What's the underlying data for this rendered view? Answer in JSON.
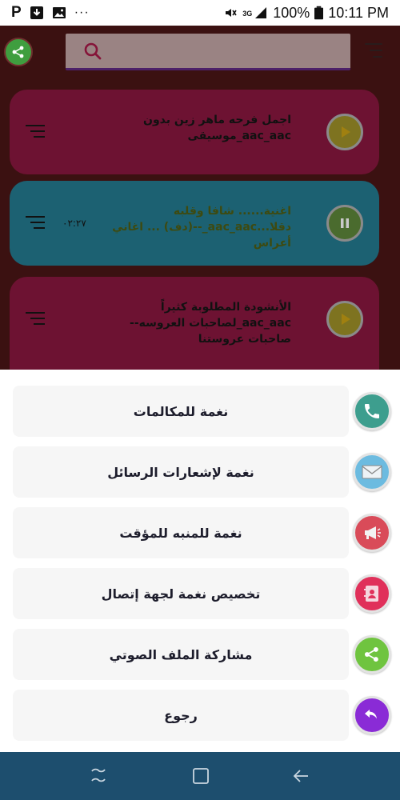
{
  "status_bar": {
    "left_letter": "P",
    "overflow": "···",
    "network": "3G",
    "battery": "100%",
    "time": "10:11 PM"
  },
  "header": {
    "search_placeholder": ""
  },
  "songs": [
    {
      "title": "اجمل فرحه ماهر زين بدون aac_aac_موسيقى",
      "time": "",
      "state": "play"
    },
    {
      "title": "اغنية...... شافا وقلبه دقلا...aac_aac_--(دف) ... اغاني أعراس",
      "time": "٠٢:٢٧",
      "state": "pause"
    },
    {
      "title": "الأنشودة المطلوبة كثيراً aac_aac_لصاحبات العروسه-- صاحبات عروستنا",
      "time": "",
      "state": "play"
    }
  ],
  "sheet": {
    "items": [
      {
        "label": "نغمة للمكالمات",
        "icon": "phone-icon",
        "color": "#3d9e8e"
      },
      {
        "label": "نغمة لإشعارات الرسائل",
        "icon": "envelope-icon",
        "color": "#6cbbe0"
      },
      {
        "label": "نغمة للمنبه للمؤقت",
        "icon": "megaphone-icon",
        "color": "#d94b59"
      },
      {
        "label": "تخصيص نغمة لجهة إتصال",
        "icon": "contact-book-icon",
        "color": "#e0305a"
      },
      {
        "label": "مشاركة الملف الصوتي",
        "icon": "share-icon",
        "color": "#6fc43f"
      },
      {
        "label": "رجوع",
        "icon": "undo-icon",
        "color": "#8a2bd6"
      }
    ]
  },
  "colors": {
    "nav_bar": "#1d4e6e",
    "card_pink": "#6d1232",
    "card_blue": "#1c6172"
  }
}
